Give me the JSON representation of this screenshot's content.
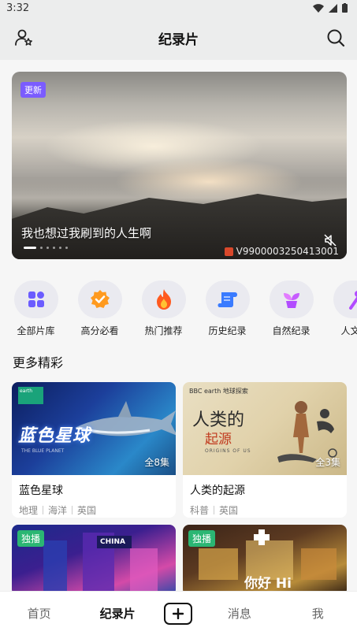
{
  "status_bar": {
    "time": "3:32"
  },
  "header": {
    "title": "纪录片",
    "left_icon": "user-star-icon",
    "right_icon": "search-icon"
  },
  "hero": {
    "badge": "更新",
    "caption": "我也想过我刷到的人生啊",
    "video_id": "V9900003250413001",
    "total_slides": 6,
    "active_slide": 1
  },
  "categories": [
    {
      "label": "全部片库",
      "icon": "grid-icon",
      "color": "#6b5cff"
    },
    {
      "label": "高分必看",
      "icon": "badge-check-icon",
      "color": "#ff8a1f"
    },
    {
      "label": "热门推荐",
      "icon": "flame-icon",
      "color": "#ff5a1f"
    },
    {
      "label": "历史纪录",
      "icon": "scroll-icon",
      "color": "#3a7bff"
    },
    {
      "label": "自然纪录",
      "icon": "sprout-icon",
      "color": "#c65cff"
    },
    {
      "label": "人文纪",
      "icon": "person-icon",
      "color": "#b24cff"
    }
  ],
  "section": {
    "title": "更多精彩"
  },
  "cards": [
    {
      "title": "蓝色星球",
      "episodes": "全8集",
      "tags": [
        "地理",
        "海洋",
        "英国"
      ],
      "poster_title": "蓝色星球",
      "poster_sub": "THE BLUE PLANET"
    },
    {
      "title": "人类的起源",
      "episodes": "全3集",
      "tags": [
        "科普",
        "英国"
      ],
      "poster_title": "人类的",
      "poster_title2": "起源",
      "poster_sub": "ORIGINS OF US",
      "poster_logo": "BBC earth 地球探索"
    }
  ],
  "small_cards": [
    {
      "badge": "独播",
      "poster_text": "CHINA"
    },
    {
      "badge": "独播",
      "poster_text": "你好 Hi"
    }
  ],
  "bottom_nav": {
    "items": [
      "首页",
      "纪录片",
      "消息",
      "我"
    ],
    "active": "纪录片"
  }
}
